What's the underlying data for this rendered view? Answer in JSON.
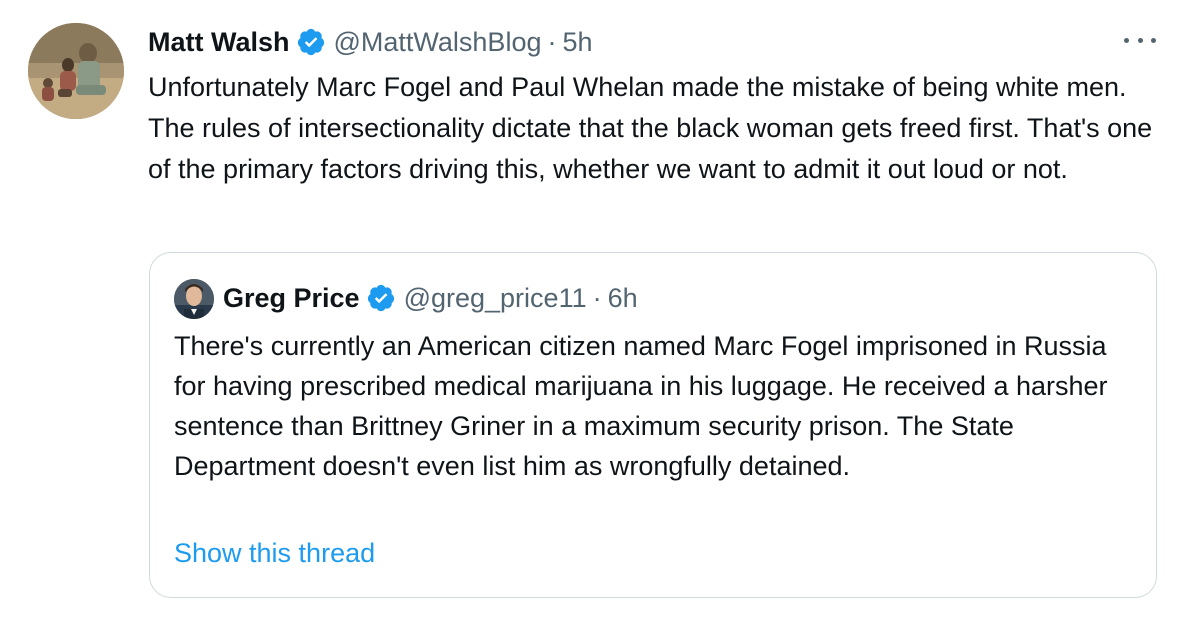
{
  "tweet": {
    "author_name": "Matt Walsh",
    "author_handle": "@MattWalshBlog",
    "separator": "·",
    "timestamp": "5h",
    "text": "Unfortunately Marc Fogel and Paul Whelan made the mistake of being white men. The rules of intersectionality dictate that the black woman gets freed first. That's one of the primary factors driving this, whether we want to admit it out loud or not.",
    "more_icon": "more-horizontal-icon"
  },
  "quoted_tweet": {
    "author_name": "Greg Price",
    "author_handle": "@greg_price11",
    "separator": "·",
    "timestamp": "6h",
    "text": "There's currently an American citizen named Marc Fogel imprisoned in Russia for having prescribed medical marijuana in his luggage. He received a harsher sentence than Brittney Griner in a maximum security prison. The State Department doesn't even list him as wrongfully detained.",
    "show_thread_label": "Show this thread"
  },
  "colors": {
    "text_primary": "#0f1419",
    "text_secondary": "#536471",
    "accent": "#1d9bf0",
    "border": "#cfd9de",
    "verified_badge": "#1d9bf0"
  }
}
